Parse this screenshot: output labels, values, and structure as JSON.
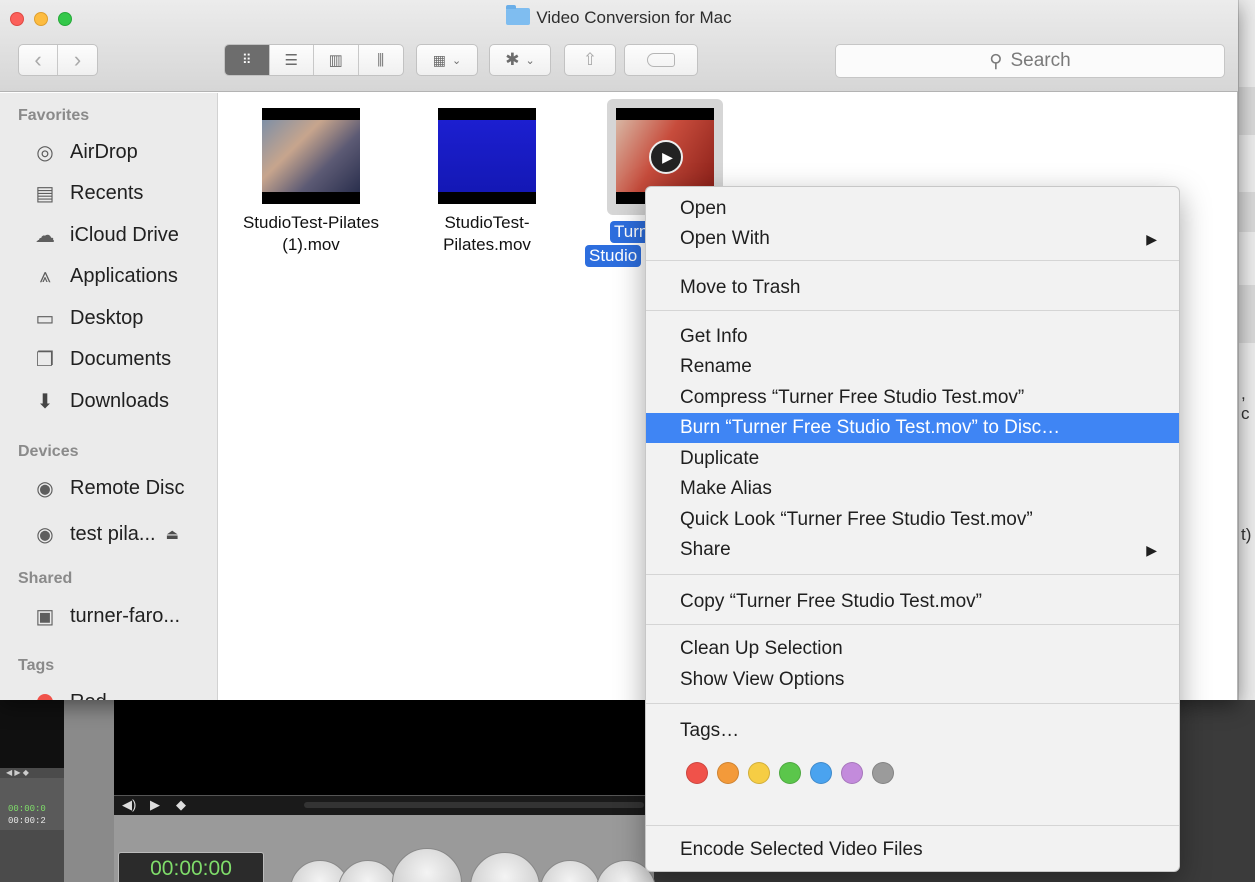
{
  "window": {
    "title": "Video Conversion for Mac"
  },
  "toolbar": {
    "search_placeholder": "Search"
  },
  "sidebar": {
    "favorites_heading": "Favorites",
    "favorites": [
      "AirDrop",
      "Recents",
      "iCloud Drive",
      "Applications",
      "Desktop",
      "Documents",
      "Downloads"
    ],
    "devices_heading": "Devices",
    "devices": [
      "Remote Disc",
      "test pila..."
    ],
    "shared_heading": "Shared",
    "shared": [
      "turner-faro..."
    ],
    "tags_heading": "Tags",
    "tags": [
      "Red"
    ]
  },
  "files": [
    {
      "name_line1": "StudioTest-Pilates",
      "name_line2": "(1).mov"
    },
    {
      "name_line1": "StudioTest-",
      "name_line2": "Pilates.mov"
    },
    {
      "name_line1": "Turn",
      "name_line2": "Studio"
    }
  ],
  "context_menu": {
    "open": "Open",
    "open_with": "Open With",
    "move_to_trash": "Move to Trash",
    "get_info": "Get Info",
    "rename": "Rename",
    "compress": "Compress “Turner Free Studio Test.mov”",
    "burn": "Burn “Turner Free Studio Test.mov” to Disc…",
    "duplicate": "Duplicate",
    "make_alias": "Make Alias",
    "quick_look": "Quick Look “Turner Free Studio Test.mov”",
    "share": "Share",
    "copy": "Copy “Turner Free Studio Test.mov”",
    "clean_up": "Clean Up Selection",
    "show_view_options": "Show View Options",
    "tags": "Tags…",
    "tag_colors": [
      "#f0524a",
      "#f39a3a",
      "#f6cd44",
      "#5bc64b",
      "#4aa3ef",
      "#c38bdc",
      "#9b9b9b"
    ],
    "encode": "Encode Selected Video Files"
  },
  "background_app": {
    "timecode_main": "00:00:00",
    "timecode_small_1": "00:00:0",
    "timecode_small_2": "00:00:2",
    "right_fragment_1": ", c",
    "right_fragment_2": "t)"
  }
}
